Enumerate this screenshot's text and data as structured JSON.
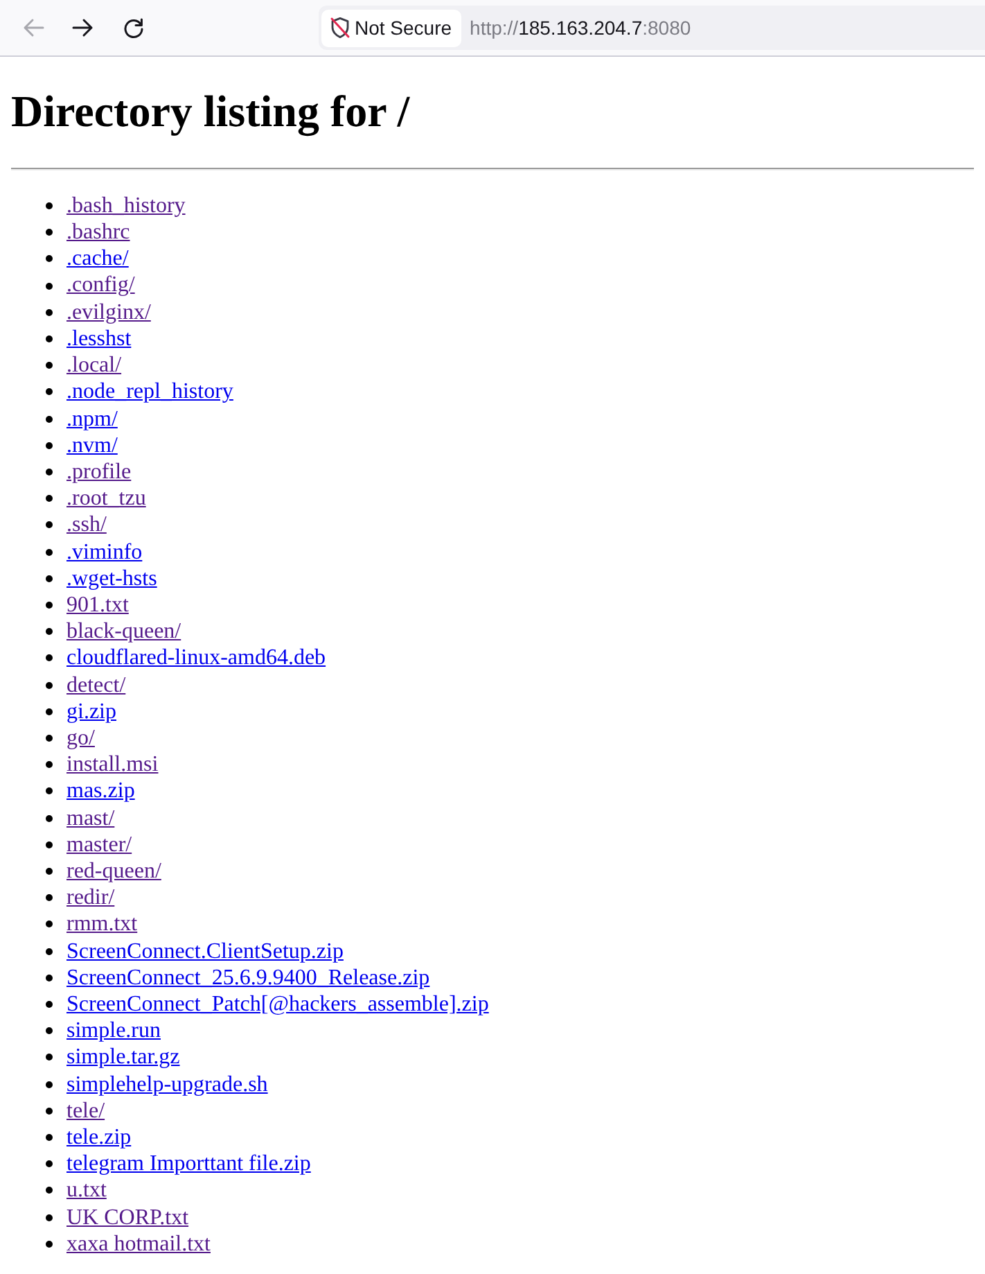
{
  "toolbar": {
    "nav_buttons": [
      {
        "kind": "back",
        "disabled": true
      },
      {
        "kind": "forward",
        "disabled": false
      },
      {
        "kind": "reload",
        "disabled": false
      }
    ],
    "security_chip": {
      "label": "Not Secure"
    },
    "address": {
      "scheme": "http://",
      "host": "185.163.204.7",
      "port": ":8080"
    }
  },
  "page": {
    "heading": "Directory listing for /",
    "entries": [
      {
        "name": ".bash_history",
        "visited": true
      },
      {
        "name": ".bashrc",
        "visited": true
      },
      {
        "name": ".cache/",
        "visited": false
      },
      {
        "name": ".config/",
        "visited": true
      },
      {
        "name": ".evilginx/",
        "visited": true
      },
      {
        "name": ".lesshst",
        "visited": false
      },
      {
        "name": ".local/",
        "visited": true
      },
      {
        "name": ".node_repl_history",
        "visited": false
      },
      {
        "name": ".npm/",
        "visited": false
      },
      {
        "name": ".nvm/",
        "visited": false
      },
      {
        "name": ".profile",
        "visited": true
      },
      {
        "name": ".root_tzu",
        "visited": true
      },
      {
        "name": ".ssh/",
        "visited": true
      },
      {
        "name": ".viminfo",
        "visited": false
      },
      {
        "name": ".wget-hsts",
        "visited": false
      },
      {
        "name": "901.txt",
        "visited": true
      },
      {
        "name": "black-queen/",
        "visited": true
      },
      {
        "name": "cloudflared-linux-amd64.deb",
        "visited": false
      },
      {
        "name": "detect/",
        "visited": true
      },
      {
        "name": "gi.zip",
        "visited": false
      },
      {
        "name": "go/",
        "visited": true
      },
      {
        "name": "install.msi",
        "visited": true
      },
      {
        "name": "mas.zip",
        "visited": false
      },
      {
        "name": "mast/",
        "visited": true
      },
      {
        "name": "master/",
        "visited": true
      },
      {
        "name": "red-queen/",
        "visited": true
      },
      {
        "name": "redir/",
        "visited": true
      },
      {
        "name": "rmm.txt",
        "visited": true
      },
      {
        "name": "ScreenConnect.ClientSetup.zip",
        "visited": false
      },
      {
        "name": "ScreenConnect_25.6.9.9400_Release.zip",
        "visited": false
      },
      {
        "name": "ScreenConnect_Patch[@hackers_assemble].zip",
        "visited": false
      },
      {
        "name": "simple.run",
        "visited": false
      },
      {
        "name": "simple.tar.gz",
        "visited": false
      },
      {
        "name": "simplehelp-upgrade.sh",
        "visited": false
      },
      {
        "name": "tele/",
        "visited": true
      },
      {
        "name": "tele.zip",
        "visited": false
      },
      {
        "name": "telegram Importtant file.zip",
        "visited": false
      },
      {
        "name": "u.txt",
        "visited": true
      },
      {
        "name": "UK CORP.txt",
        "visited": true
      },
      {
        "name": "xaxa hotmail.txt",
        "visited": true
      }
    ]
  }
}
